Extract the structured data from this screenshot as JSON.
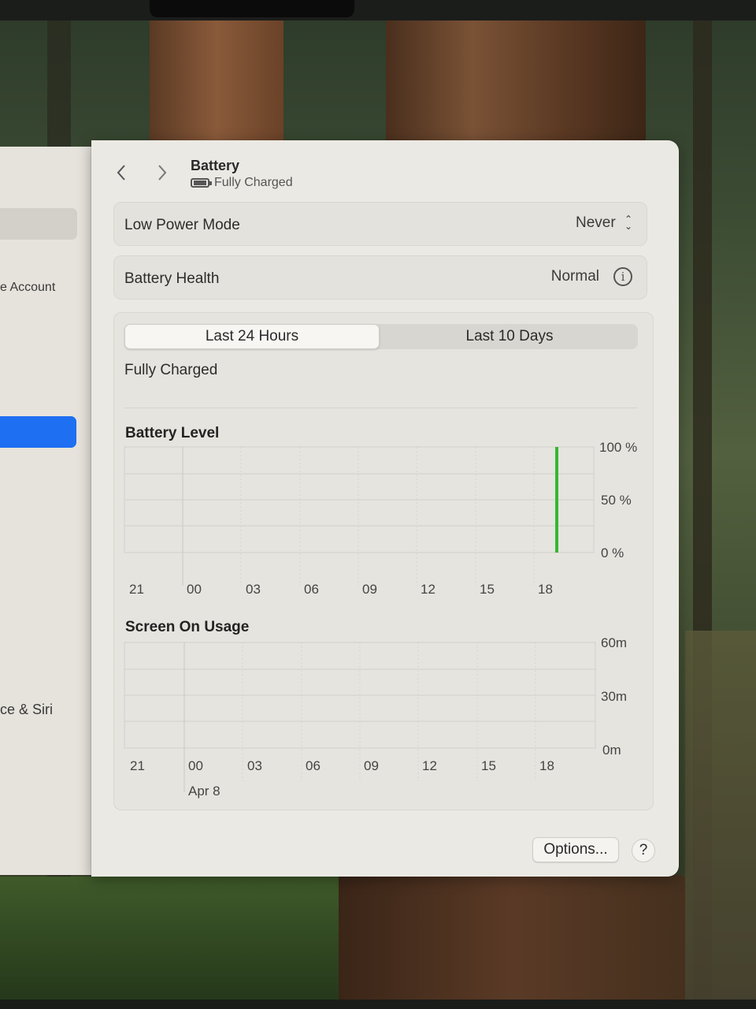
{
  "sidebar": {
    "items": [
      {
        "label": "e Account"
      },
      {
        "label": "ce & Siri"
      }
    ]
  },
  "header": {
    "title": "Battery",
    "subtitle": "Fully Charged",
    "back_icon": "chevron-left-icon",
    "forward_icon": "chevron-right-icon"
  },
  "settings": {
    "low_power_mode": {
      "label": "Low Power Mode",
      "value": "Never"
    },
    "battery_health": {
      "label": "Battery Health",
      "value": "Normal"
    }
  },
  "tabs": [
    {
      "label": "Last 24 Hours",
      "selected": true
    },
    {
      "label": "Last 10 Days",
      "selected": false
    }
  ],
  "status_text": "Fully Charged",
  "battery_chart": {
    "title": "Battery Level",
    "y_labels": [
      "100 %",
      "50 %",
      "0 %"
    ],
    "x_labels": [
      "21",
      "00",
      "03",
      "06",
      "09",
      "12",
      "15",
      "18"
    ]
  },
  "usage_chart": {
    "title": "Screen On Usage",
    "y_labels": [
      "60m",
      "30m",
      "0m"
    ],
    "x_labels": [
      "21",
      "00",
      "03",
      "06",
      "09",
      "12",
      "15",
      "18"
    ],
    "date_label": "Apr 8"
  },
  "chart_data": [
    {
      "type": "bar",
      "title": "Battery Level",
      "x": [
        "21",
        "00",
        "03",
        "06",
        "09",
        "12",
        "15",
        "18"
      ],
      "ylim": [
        0,
        100
      ],
      "series": [
        {
          "values": [
            {
              "x": "18",
              "value": 100
            }
          ]
        }
      ],
      "accent_color": "#35b82f"
    },
    {
      "type": "bar",
      "title": "Screen On Usage",
      "x": [
        "21",
        "00",
        "03",
        "06",
        "09",
        "12",
        "15",
        "18"
      ],
      "ylim": [
        0,
        60
      ],
      "series": [
        {
          "values": []
        }
      ]
    }
  ],
  "footer": {
    "options_label": "Options...",
    "help_label": "?"
  },
  "colors": {
    "accent_blue": "#1e6ff1",
    "battery_green": "#35b82f"
  }
}
